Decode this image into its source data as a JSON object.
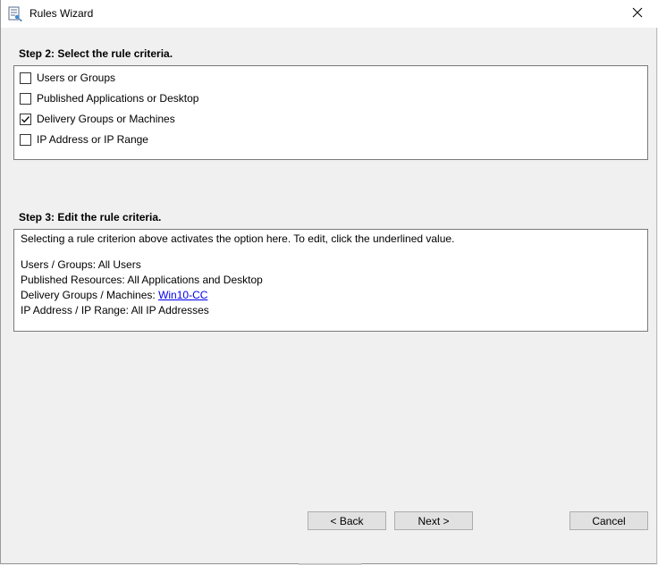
{
  "window": {
    "title": "Rules Wizard",
    "icons": {
      "app": "rules-wizard-app-icon",
      "close": "close-icon"
    }
  },
  "step2": {
    "heading": "Step 2: Select the rule criteria.",
    "criteria": [
      {
        "label": "Users or Groups",
        "checked": false
      },
      {
        "label": "Published Applications or Desktop",
        "checked": false
      },
      {
        "label": "Delivery Groups or Machines",
        "checked": true
      },
      {
        "label": "IP Address or IP Range",
        "checked": false
      }
    ]
  },
  "step3": {
    "heading": "Step 3: Edit the rule criteria.",
    "instructions": "Selecting a rule criterion above activates the option here. To edit, click the underlined value.",
    "rules": [
      {
        "label": "Users / Groups: ",
        "value": "All Users",
        "link": false
      },
      {
        "label": "Published Resources: ",
        "value": "All Applications and Desktop",
        "link": false
      },
      {
        "label": "Delivery Groups / Machines: ",
        "value": "Win10-CC",
        "link": true
      },
      {
        "label": "IP Address / IP Range: ",
        "value": "All IP Addresses",
        "link": false
      }
    ]
  },
  "buttons": {
    "back": "< Back",
    "next": "Next >",
    "cancel": "Cancel"
  },
  "colors": {
    "window_bg": "#f0f0f0",
    "link": "#0000ee",
    "button_bg": "#e1e1e1"
  }
}
